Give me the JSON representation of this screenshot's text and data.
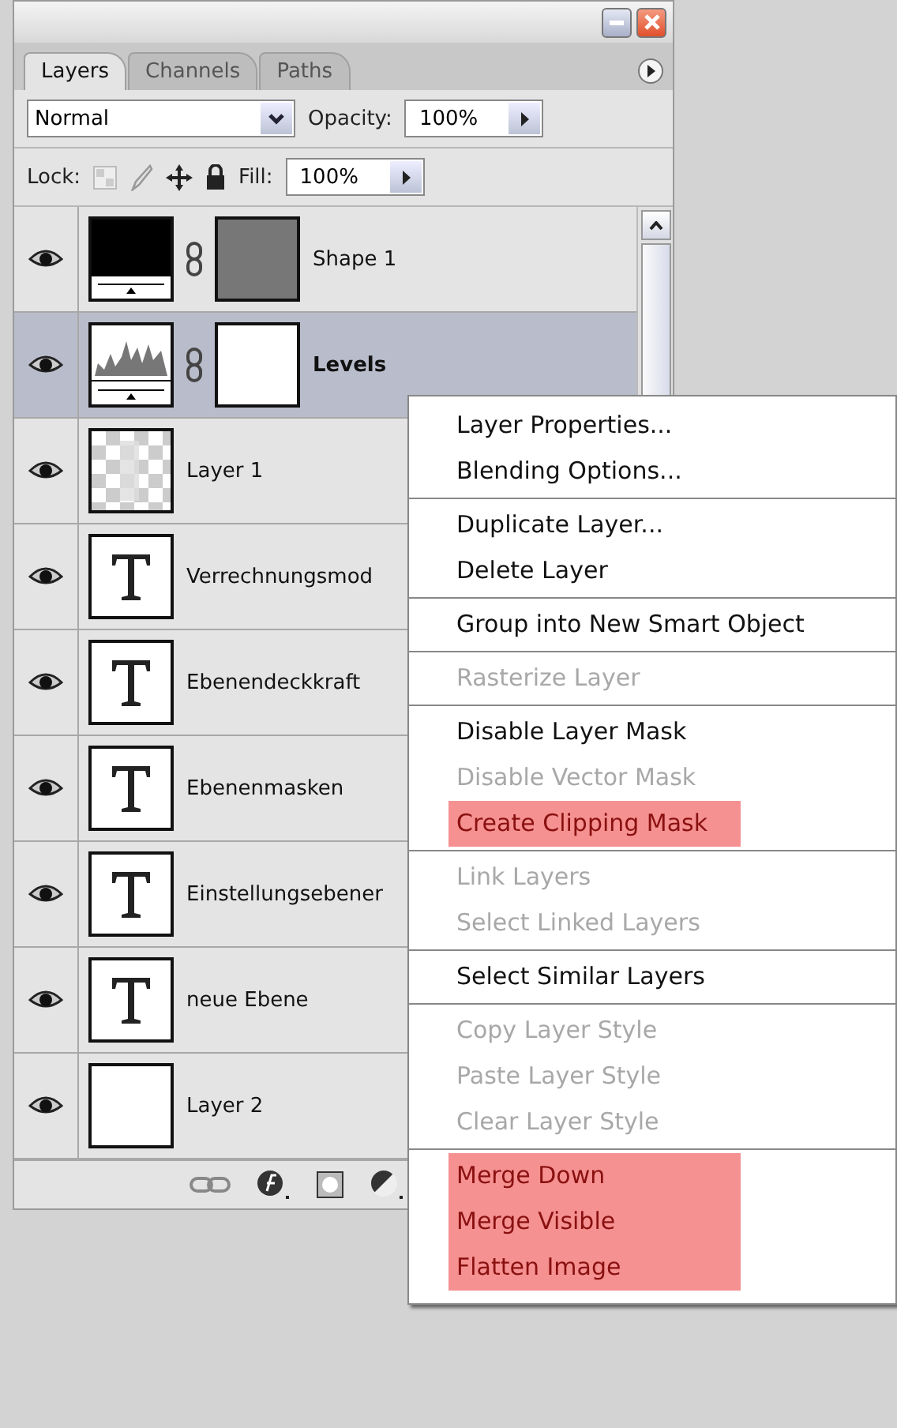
{
  "tabs": [
    {
      "label": "Layers",
      "selected": true
    },
    {
      "label": "Channels",
      "selected": false
    },
    {
      "label": "Paths",
      "selected": false
    }
  ],
  "blend_mode": "Normal",
  "opacity_label": "Opacity:",
  "opacity": "100%",
  "lock_label": "Lock:",
  "fill_label": "Fill:",
  "fill": "100%",
  "layers": [
    {
      "name": "Shape 1",
      "kind": "fill",
      "mask": true,
      "selected": false,
      "visible": true
    },
    {
      "name": "Levels",
      "kind": "levels",
      "mask": true,
      "selected": true,
      "visible": true
    },
    {
      "name": "Layer 1",
      "kind": "pixel",
      "mask": false,
      "selected": false,
      "visible": true
    },
    {
      "name": "Verrechnungsmod",
      "kind": "text",
      "mask": false,
      "selected": false,
      "visible": true
    },
    {
      "name": "Ebenendeckkraft",
      "kind": "text",
      "mask": false,
      "selected": false,
      "visible": true
    },
    {
      "name": "Ebenenmasken",
      "kind": "text",
      "mask": false,
      "selected": false,
      "visible": true
    },
    {
      "name": "Einstellungsebener",
      "kind": "text",
      "mask": false,
      "selected": false,
      "visible": true
    },
    {
      "name": "neue Ebene",
      "kind": "text",
      "mask": false,
      "selected": false,
      "visible": true
    },
    {
      "name": "Layer 2",
      "kind": "blank",
      "mask": false,
      "selected": false,
      "visible": true
    }
  ],
  "context_menu": [
    [
      {
        "label": "Layer Properties...",
        "disabled": false,
        "highlighted": false
      },
      {
        "label": "Blending Options...",
        "disabled": false,
        "highlighted": false
      }
    ],
    [
      {
        "label": "Duplicate Layer...",
        "disabled": false,
        "highlighted": false
      },
      {
        "label": "Delete Layer",
        "disabled": false,
        "highlighted": false
      }
    ],
    [
      {
        "label": "Group into New Smart Object",
        "disabled": false,
        "highlighted": false
      }
    ],
    [
      {
        "label": "Rasterize Layer",
        "disabled": true,
        "highlighted": false
      }
    ],
    [
      {
        "label": "Disable Layer Mask",
        "disabled": false,
        "highlighted": false
      },
      {
        "label": "Disable Vector Mask",
        "disabled": true,
        "highlighted": false
      },
      {
        "label": "Create Clipping Mask",
        "disabled": false,
        "highlighted": true
      }
    ],
    [
      {
        "label": "Link Layers",
        "disabled": true,
        "highlighted": false
      },
      {
        "label": "Select Linked Layers",
        "disabled": true,
        "highlighted": false
      }
    ],
    [
      {
        "label": "Select Similar Layers",
        "disabled": false,
        "highlighted": false
      }
    ],
    [
      {
        "label": "Copy Layer Style",
        "disabled": true,
        "highlighted": false
      },
      {
        "label": "Paste Layer Style",
        "disabled": true,
        "highlighted": false
      },
      {
        "label": "Clear Layer Style",
        "disabled": true,
        "highlighted": false
      }
    ],
    [
      {
        "label": "Merge Down",
        "disabled": false,
        "highlighted": true
      },
      {
        "label": "Merge Visible",
        "disabled": false,
        "highlighted": true
      },
      {
        "label": "Flatten Image",
        "disabled": false,
        "highlighted": true
      }
    ]
  ]
}
